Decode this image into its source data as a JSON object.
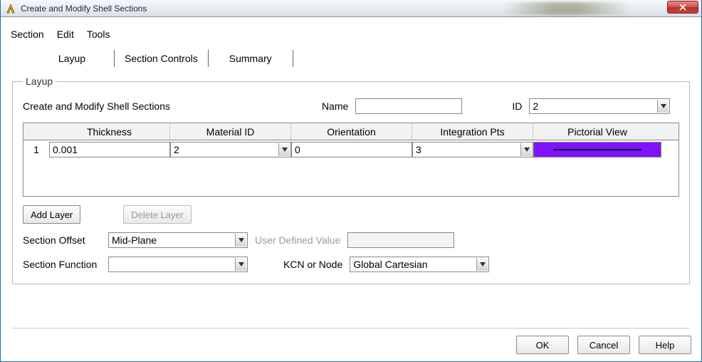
{
  "window": {
    "title": "Create and Modify Shell Sections"
  },
  "menu": {
    "section": "Section",
    "edit": "Edit",
    "tools": "Tools"
  },
  "tabs": {
    "layup": "Layup",
    "section_controls": "Section Controls",
    "summary": "Summary"
  },
  "group": {
    "legend": "Layup",
    "subtitle": "Create and Modify Shell Sections",
    "name_label": "Name",
    "name_value": "",
    "id_label": "ID",
    "id_value": "2"
  },
  "grid": {
    "headers": {
      "idx": "",
      "thickness": "Thickness",
      "material": "Material ID",
      "orientation": "Orientation",
      "integration": "Integration Pts",
      "pictorial": "Pictorial View"
    },
    "rows": [
      {
        "idx": "1",
        "thickness": "0.001",
        "material": "2",
        "orientation": "0",
        "integration": "3"
      }
    ]
  },
  "actions": {
    "add_layer": "Add Layer",
    "delete_layer": "Delete Layer"
  },
  "offset": {
    "label": "Section Offset",
    "value": "Mid-Plane",
    "user_label": "User Defined Value",
    "user_value": ""
  },
  "func": {
    "label": "Section Function",
    "value": "",
    "kcn_label": "KCN or Node",
    "kcn_value": "Global Cartesian"
  },
  "footer": {
    "ok": "OK",
    "cancel": "Cancel",
    "help": "Help"
  }
}
